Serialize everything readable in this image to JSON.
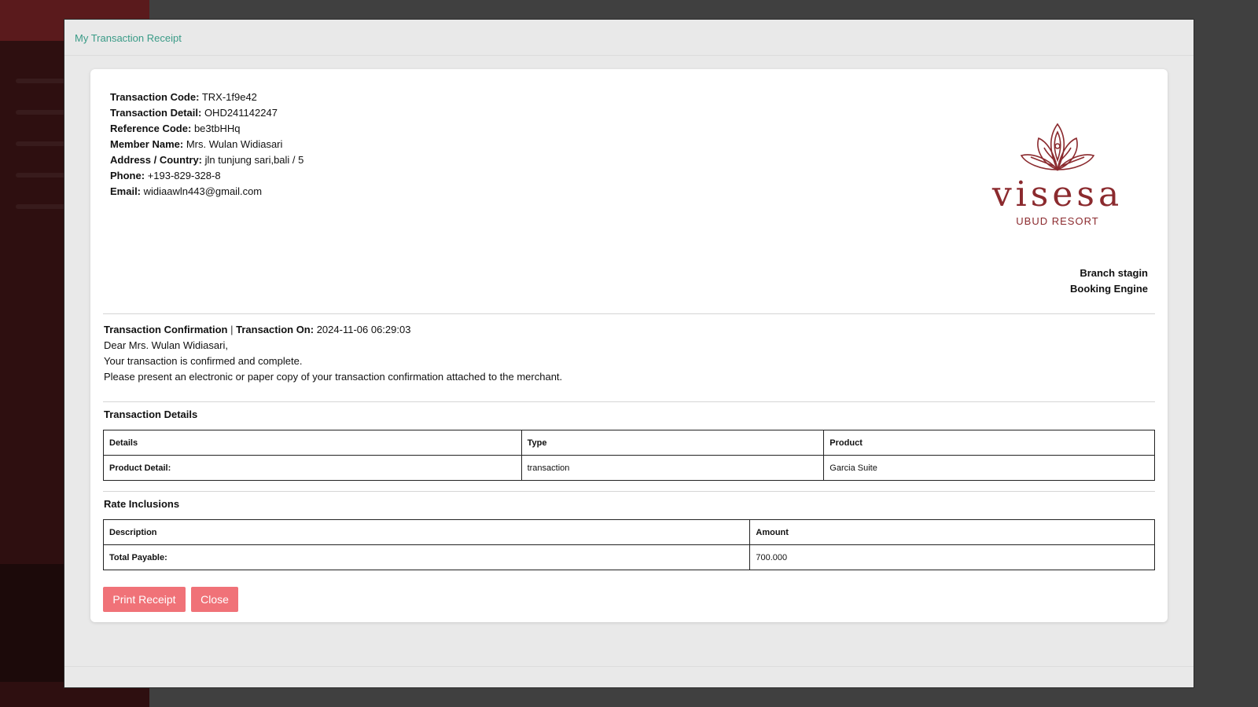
{
  "modal": {
    "title": "My Transaction Receipt"
  },
  "member": {
    "transaction_code_label": "Transaction Code:",
    "transaction_code": "TRX-1f9e42",
    "transaction_detail_label": "Transaction Detail:",
    "transaction_detail": "OHD241142247",
    "reference_code_label": "Reference Code:",
    "reference_code": "be3tbHHq",
    "member_name_label": "Member Name:",
    "member_name": "Mrs. Wulan Widiasari",
    "address_label": "Address / Country:",
    "address": "jln tunjung sari,bali / 5",
    "phone_label": "Phone:",
    "phone": "+193-829-328-8",
    "email_label": "Email:",
    "email": "widiaawln443@gmail.com"
  },
  "logo": {
    "word": "visesa",
    "sub": "UBUD RESORT",
    "color": "#8b2a2e"
  },
  "branch": {
    "name": "Branch stagin",
    "engine": "Booking Engine"
  },
  "confirmation": {
    "title": "Transaction Confirmation",
    "separator": "|",
    "on_label": "Transaction On:",
    "on_value": "2024-11-06 06:29:03",
    "greeting": "Dear Mrs. Wulan Widiasari,",
    "line1": "Your transaction is confirmed and complete.",
    "line2": "Please present an electronic or paper copy of your transaction confirmation attached to the merchant."
  },
  "transaction_details": {
    "title": "Transaction Details",
    "headers": [
      "Details",
      "Type",
      "Product"
    ],
    "rows": [
      [
        "Product Detail:",
        "transaction",
        "Garcia Suite"
      ]
    ]
  },
  "rate_inclusions": {
    "title": "Rate Inclusions",
    "headers": [
      "Description",
      "Amount"
    ],
    "rows": [
      [
        "Total Payable:",
        "700.000"
      ]
    ]
  },
  "buttons": {
    "print": "Print Receipt",
    "close": "Close",
    "color": "#f07278"
  }
}
